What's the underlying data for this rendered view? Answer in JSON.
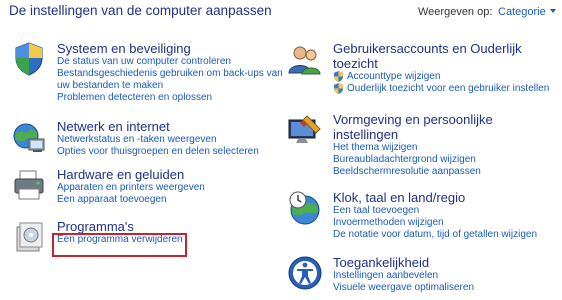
{
  "header": {
    "title": "De instellingen van de computer aanpassen",
    "view_by_label": "Weergeven op:",
    "view_by_value": "Categorie"
  },
  "left_column": [
    {
      "title": "Systeem en beveiliging",
      "links": [
        "De status van uw computer controleren",
        "Bestandsgeschiedenis gebruiken om back-ups van",
        "uw bestanden te maken",
        "Problemen detecteren en oplossen"
      ]
    },
    {
      "title": "Netwerk en internet",
      "links": [
        "Netwerkstatus en -taken weergeven",
        "Opties voor thuisgroepen en delen selecteren"
      ]
    },
    {
      "title": "Hardware en geluiden",
      "links": [
        "Apparaten en printers weergeven",
        "Een apparaat toevoegen"
      ]
    },
    {
      "title": "Programma's",
      "links": [
        "Een programma verwijderen"
      ]
    }
  ],
  "right_column": [
    {
      "title_lines": [
        "Gebruikersaccounts en Ouderlijk",
        "toezicht"
      ],
      "links": [
        "Accounttype wijzigen",
        "Ouderlijk toezicht voor een gebruiker instellen"
      ]
    },
    {
      "title_lines": [
        "Vormgeving en persoonlijke",
        "instellingen"
      ],
      "links": [
        "Het thema wijzigen",
        "Bureaubladachtergrond wijzigen",
        "Beeldschermresolutie aanpassen"
      ]
    },
    {
      "title_lines": [
        "Klok, taal en land/regio"
      ],
      "links": [
        "Een taal toevoegen",
        "Invoermethoden wijzigen",
        "De notatie voor datum, tijd of getallen wijzigen"
      ]
    },
    {
      "title_lines": [
        "Toegankelijkheid"
      ],
      "links": [
        "Instellingen aanbevelen",
        "Visuele weergave optimaliseren"
      ]
    }
  ],
  "icons": {
    "system_security": "shield-icon",
    "network_internet": "network-globe-icon",
    "hardware_sound": "printer-icon",
    "programs": "programs-box-icon",
    "user_accounts": "users-icon",
    "appearance": "display-brush-icon",
    "clock_region": "clock-globe-icon",
    "ease_of_access": "accessibility-icon",
    "uac_shield": "uac-shield-icon"
  },
  "colors": {
    "title": "#1e3287",
    "link": "#1a5cb8",
    "highlight": "#c0272d"
  }
}
